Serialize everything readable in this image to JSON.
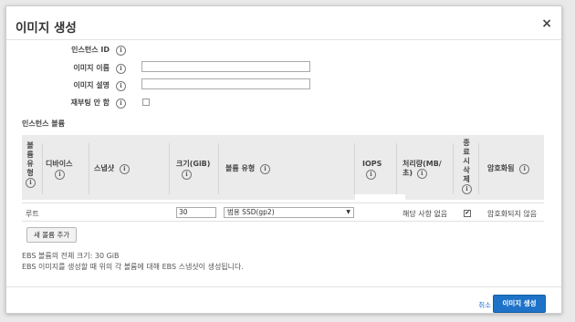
{
  "dialog": {
    "title": "이미지 생성",
    "close_glyph": "×"
  },
  "info_glyph": "i",
  "form": {
    "instance_id_label": "인스턴스 ID",
    "image_name_label": "이미지 이름",
    "image_name_value": "",
    "image_desc_label": "이미지 설명",
    "image_desc_value": "",
    "no_reboot_label": "재부팅 안 함"
  },
  "volumes": {
    "section_title": "인스턴스 볼륨",
    "headers": {
      "volume_type": [
        "볼",
        "륨",
        "유",
        "형"
      ],
      "device": "디바이스",
      "snapshot": "스냅샷",
      "size": "크기(GiB)",
      "volume_kind": "볼륨 유형",
      "iops": "IOPS",
      "throughput_1": "처리량(MB/",
      "throughput_2": "초)",
      "delete_on_term": [
        "종",
        "료",
        "시",
        "삭",
        "제"
      ],
      "encryption": "암호화됨"
    },
    "row": {
      "type": "루트",
      "size": "30",
      "volume_kind": "범용 SSD(gp2)",
      "throughput": "해당 사항 없음",
      "delete_checked": "✔",
      "encryption": "암호화되지 않음"
    },
    "add_button": "새 볼륨 추가"
  },
  "notes": {
    "total": "EBS 볼륨의 전체 크기: 30 GiB",
    "info": "EBS 이미지를 생성할 때 위의 각 볼륨에 대해 EBS 스냅샷이 생성됩니다."
  },
  "footer": {
    "cancel": "취소",
    "create": "이미지 생성"
  },
  "colors": {
    "primary": "#1e73c8",
    "link": "#1e6fd0",
    "header_bg": "#ebebeb"
  }
}
